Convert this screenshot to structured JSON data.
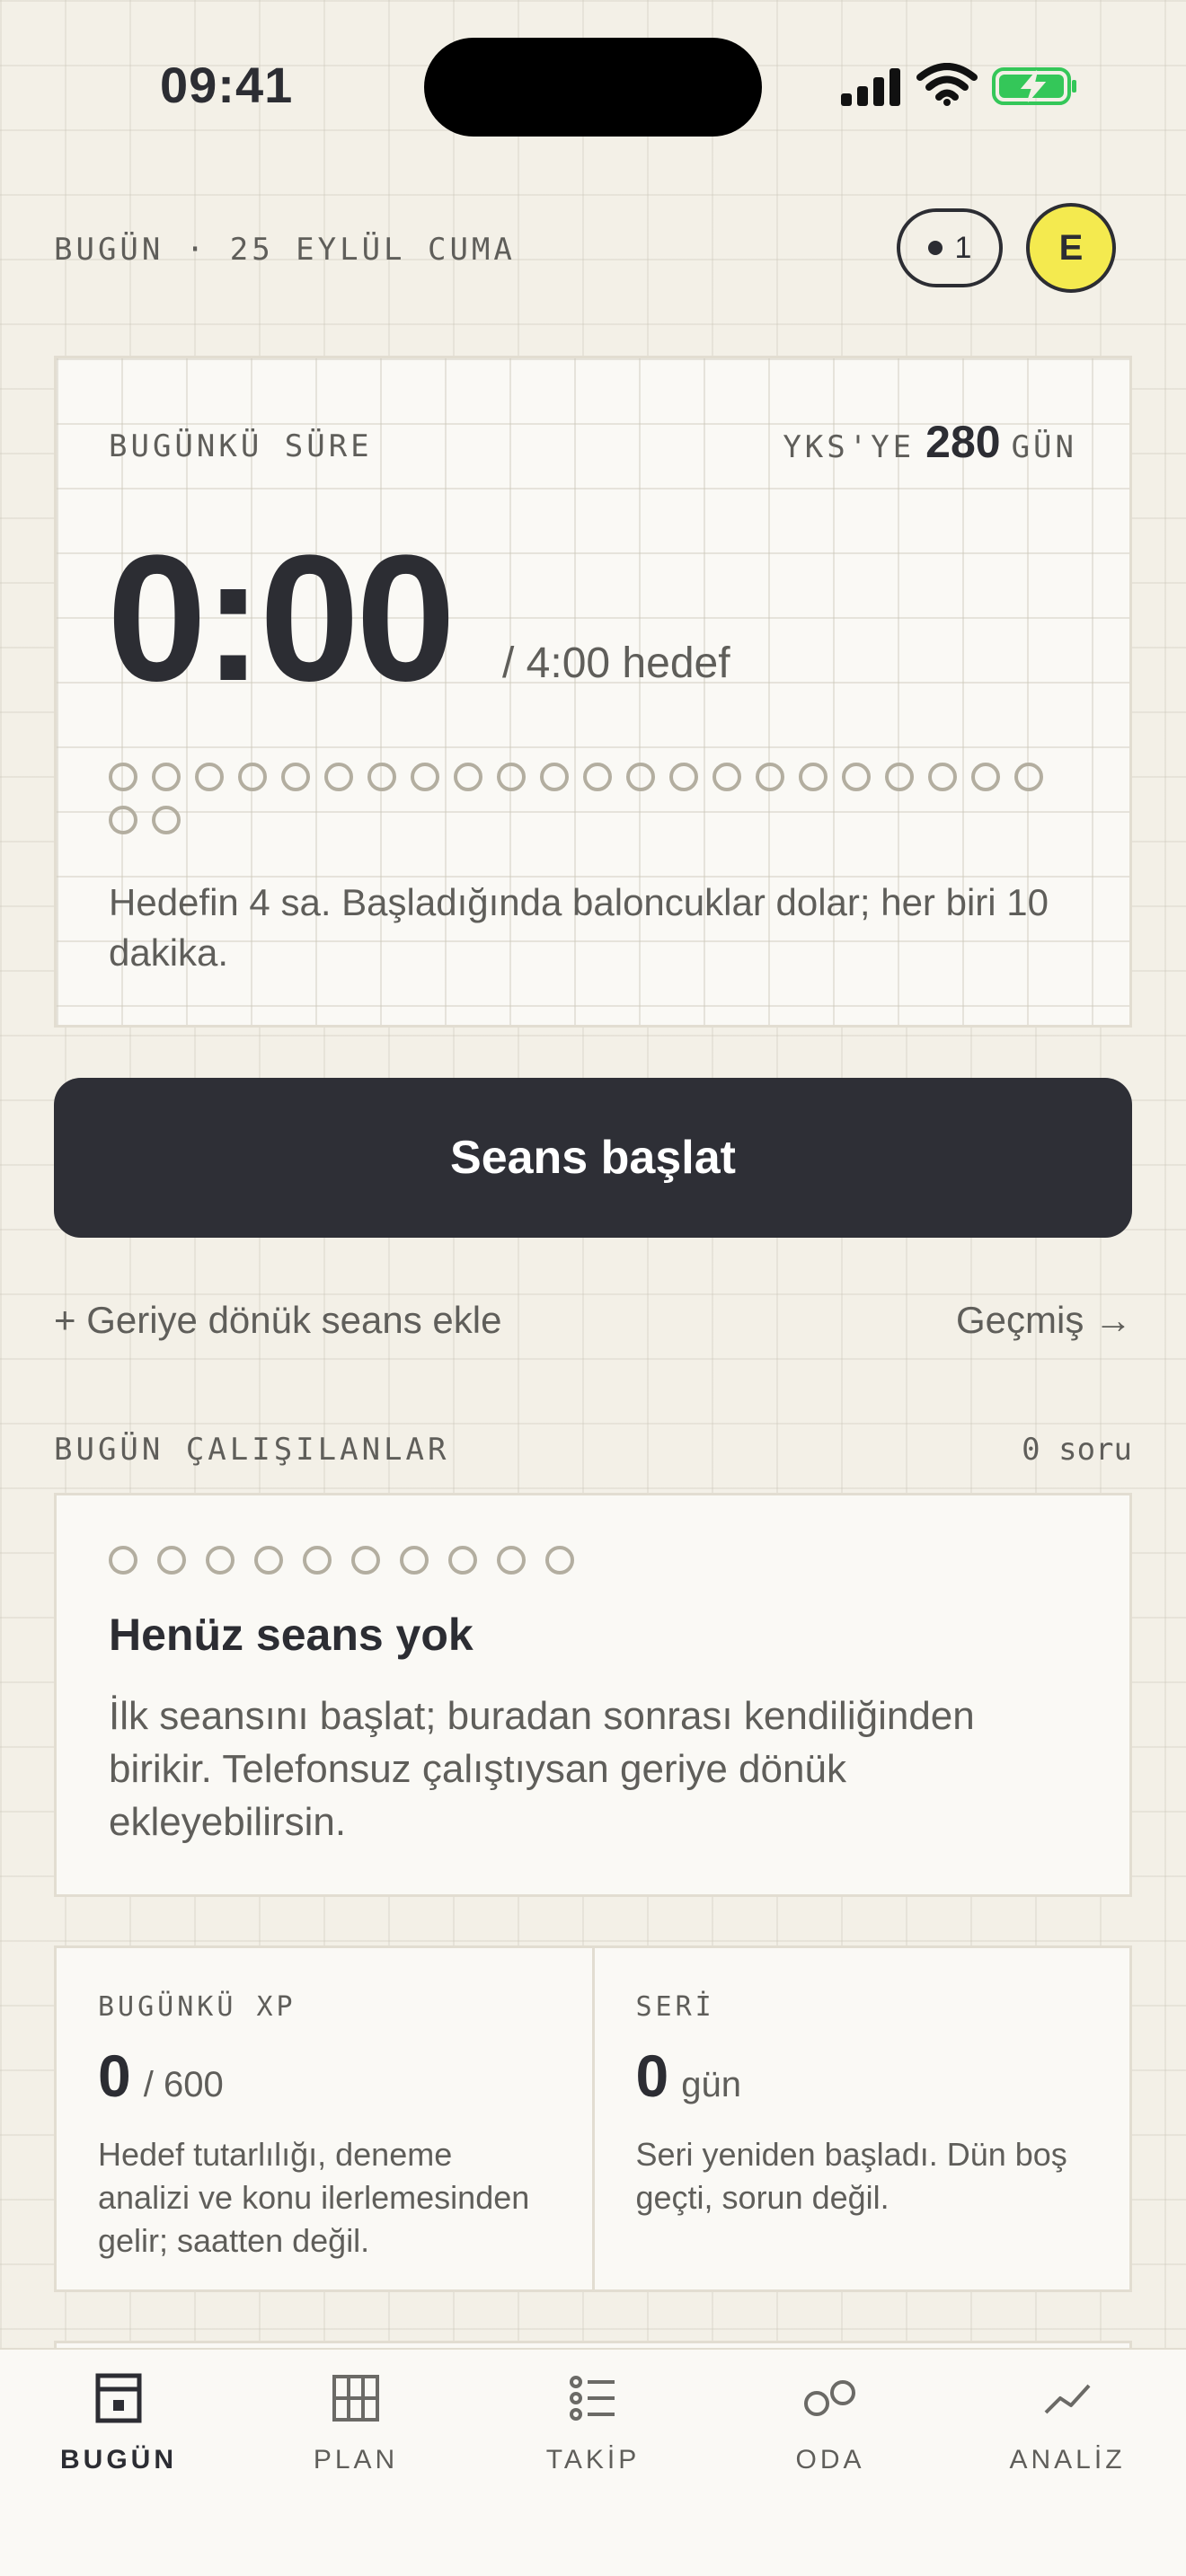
{
  "status_bar": {
    "time": "09:41"
  },
  "header": {
    "date_label": "BUGÜN · 25 EYLÜL CUMA",
    "notification_count": "1",
    "avatar_initial": "E"
  },
  "timer_card": {
    "label": "BUGÜNKÜ SÜRE",
    "yks_prefix": "YKS'YE",
    "yks_days": "280",
    "yks_suffix": "GÜN",
    "time": "0:00",
    "goal": "/ 4:00 hedef",
    "bubbles_filled": 0,
    "bubbles_total": 24,
    "note": "Hedefin 4 sa. Başladığında baloncuklar dolar; her biri 10 dakika."
  },
  "start_button": {
    "label": "Seans başlat"
  },
  "links": {
    "retro": "+ Geriye dönük seans ekle",
    "history": "Geçmiş →"
  },
  "studied_section": {
    "label": "BUGÜN ÇALIŞILANLAR",
    "count": "0 soru"
  },
  "empty_state": {
    "bubbles_total": 10,
    "title": "Henüz seans yok",
    "text": "İlk seansını başlat; buradan sonrası kendiliğinden birikir. Telefonsuz çalıştıysan geriye dönük ekleyebilirsin."
  },
  "stats": {
    "xp": {
      "label": "BUGÜNKÜ XP",
      "value": "0",
      "unit": "/ 600",
      "desc": "Hedef tutarlılığı, deneme analizi ve konu ilerlemesinden gelir; saatten değil."
    },
    "streak": {
      "label": "SERİ",
      "value": "0",
      "unit": "gün",
      "desc": "Seri yeniden başladı. Dün boş geçti, sorun değil."
    }
  },
  "tabs": [
    {
      "label": "BUGÜN",
      "icon": "today-icon",
      "active": true
    },
    {
      "label": "PLAN",
      "icon": "grid-icon",
      "active": false
    },
    {
      "label": "TAKİP",
      "icon": "list-icon",
      "active": false
    },
    {
      "label": "ODA",
      "icon": "room-icon",
      "active": false
    },
    {
      "label": "ANALİZ",
      "icon": "chart-line-icon",
      "active": false
    }
  ],
  "colors": {
    "background": "#f3f0e7",
    "card": "#faf9f5",
    "primary_dark": "#2e2f36",
    "avatar_yellow": "#f4ea4f",
    "battery_green": "#34c759"
  }
}
